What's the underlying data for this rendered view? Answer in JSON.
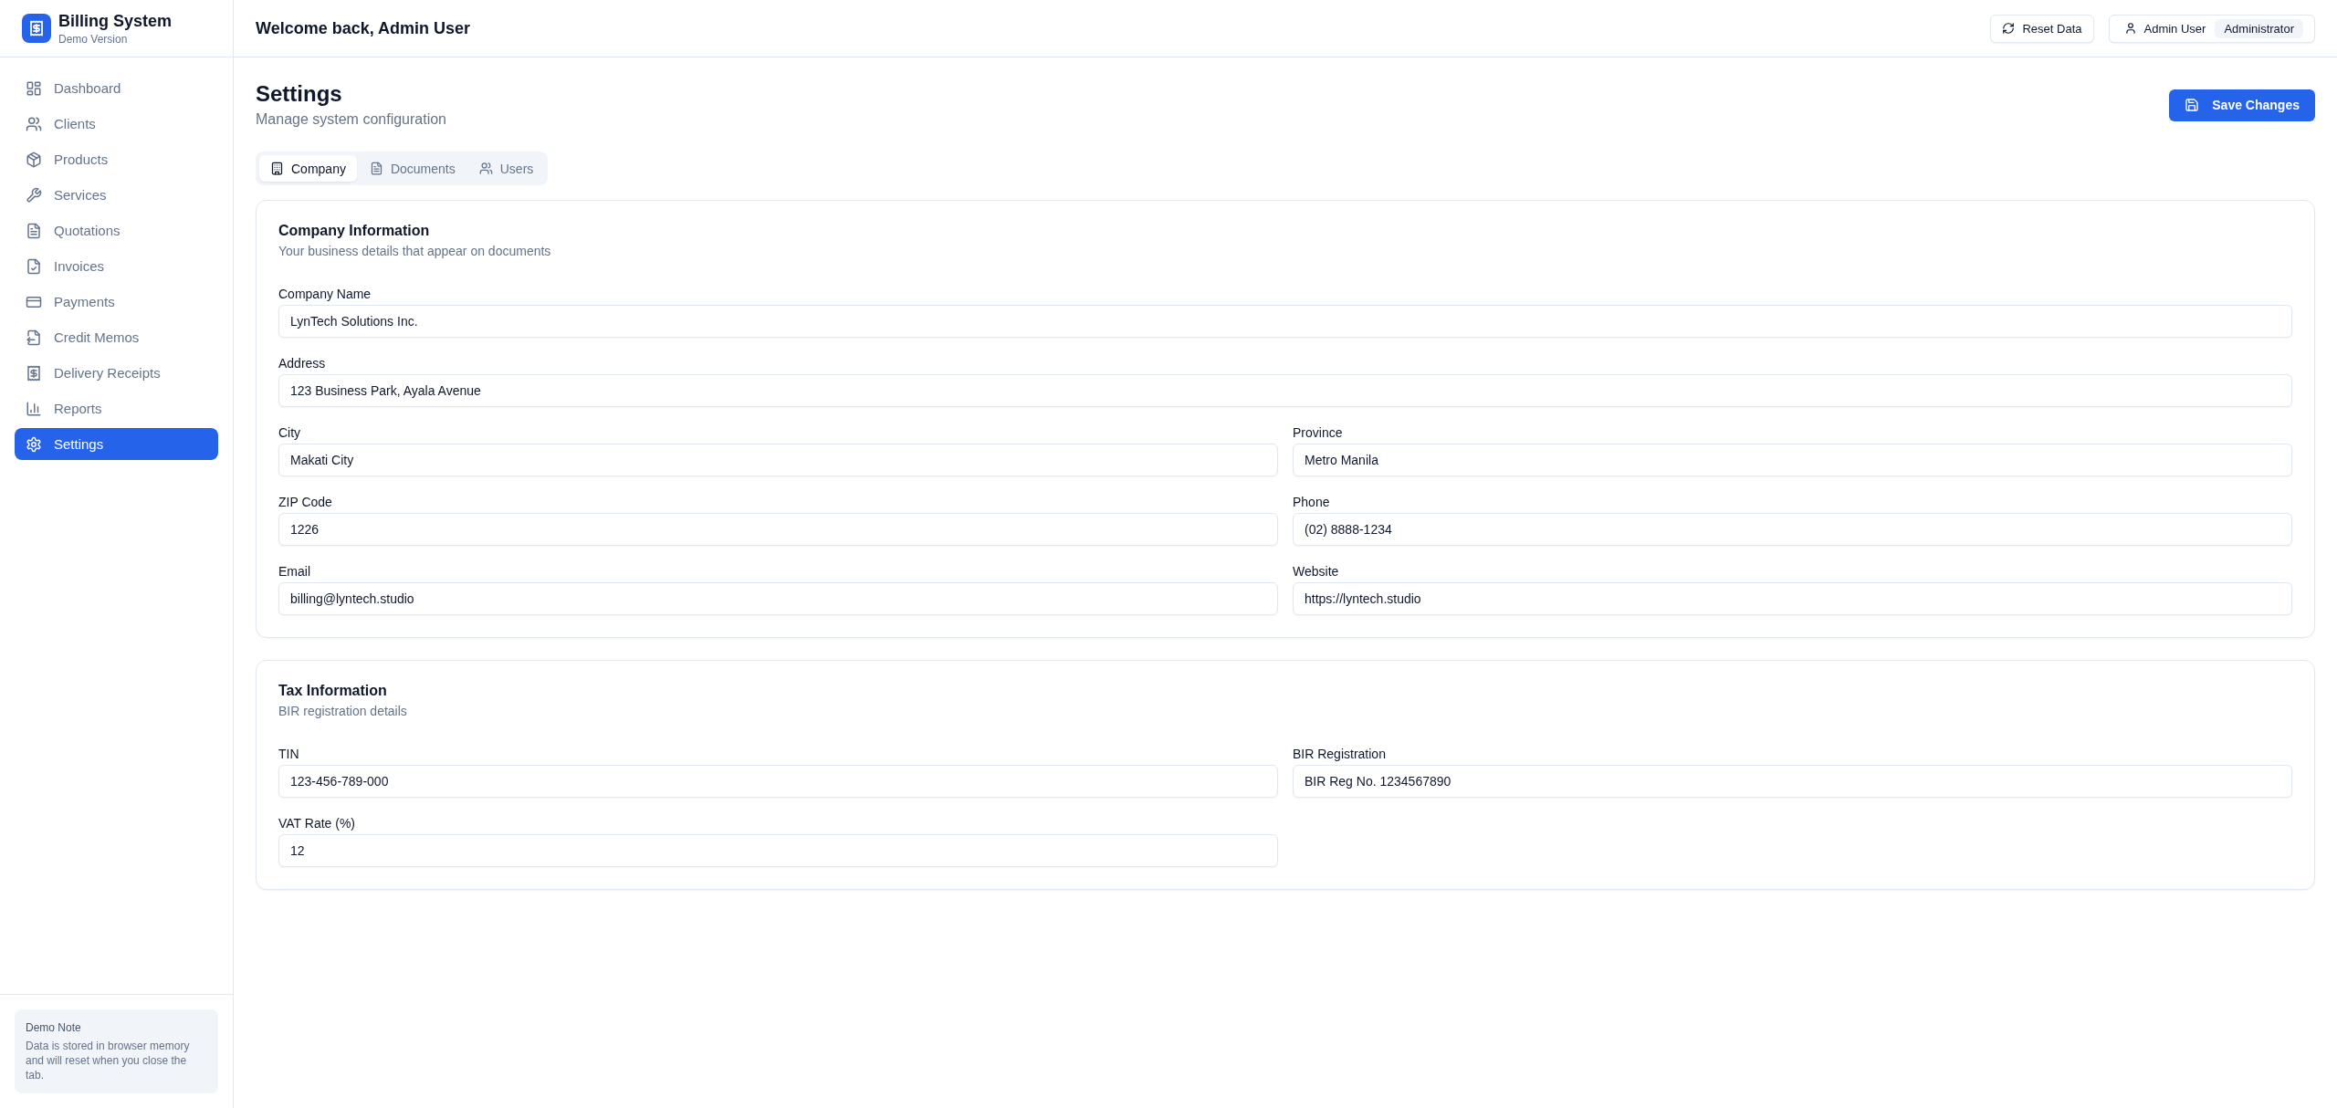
{
  "sidebar": {
    "brand": {
      "title": "Billing System",
      "subtitle": "Demo Version"
    },
    "items": [
      {
        "label": "Dashboard",
        "selected": false
      },
      {
        "label": "Clients",
        "selected": false
      },
      {
        "label": "Products",
        "selected": false
      },
      {
        "label": "Services",
        "selected": false
      },
      {
        "label": "Quotations",
        "selected": false
      },
      {
        "label": "Invoices",
        "selected": false
      },
      {
        "label": "Payments",
        "selected": false
      },
      {
        "label": "Credit Memos",
        "selected": false
      },
      {
        "label": "Delivery Receipts",
        "selected": false
      },
      {
        "label": "Reports",
        "selected": false
      },
      {
        "label": "Settings",
        "selected": true
      }
    ],
    "note": {
      "title": "Demo Note",
      "text": "Data is stored in browser memory and will reset when you close the tab."
    }
  },
  "header": {
    "greeting": "Welcome back, Admin User",
    "reset_button": "Reset Data",
    "user": {
      "name": "Admin User",
      "role": "Administrator"
    }
  },
  "page": {
    "title": "Settings",
    "subtitle": "Manage system configuration",
    "save_button": "Save Changes"
  },
  "tabs": [
    {
      "label": "Company",
      "selected": true
    },
    {
      "label": "Documents",
      "selected": false
    },
    {
      "label": "Users",
      "selected": false
    }
  ],
  "sections": [
    {
      "title": "Company Information",
      "description": "Your business details that appear on documents",
      "fields": [
        {
          "label": "Company Name",
          "value": "LynTech Solutions Inc."
        },
        {
          "label": "Address",
          "value": "123 Business Park, Ayala Avenue"
        },
        {
          "label": "City",
          "value": "Makati City"
        },
        {
          "label": "Province",
          "value": "Metro Manila"
        },
        {
          "label": "ZIP Code",
          "value": "1226"
        },
        {
          "label": "Phone",
          "value": "(02) 8888-1234"
        },
        {
          "label": "Email",
          "value": "billing@lyntech.studio"
        },
        {
          "label": "Website",
          "value": "https://lyntech.studio"
        }
      ]
    },
    {
      "title": "Tax Information",
      "description": "BIR registration details",
      "fields": [
        {
          "label": "TIN",
          "value": "123-456-789-000"
        },
        {
          "label": "BIR Registration",
          "value": "BIR Reg No. 1234567890"
        },
        {
          "label": "VAT Rate (%)",
          "value": "12"
        }
      ]
    }
  ]
}
